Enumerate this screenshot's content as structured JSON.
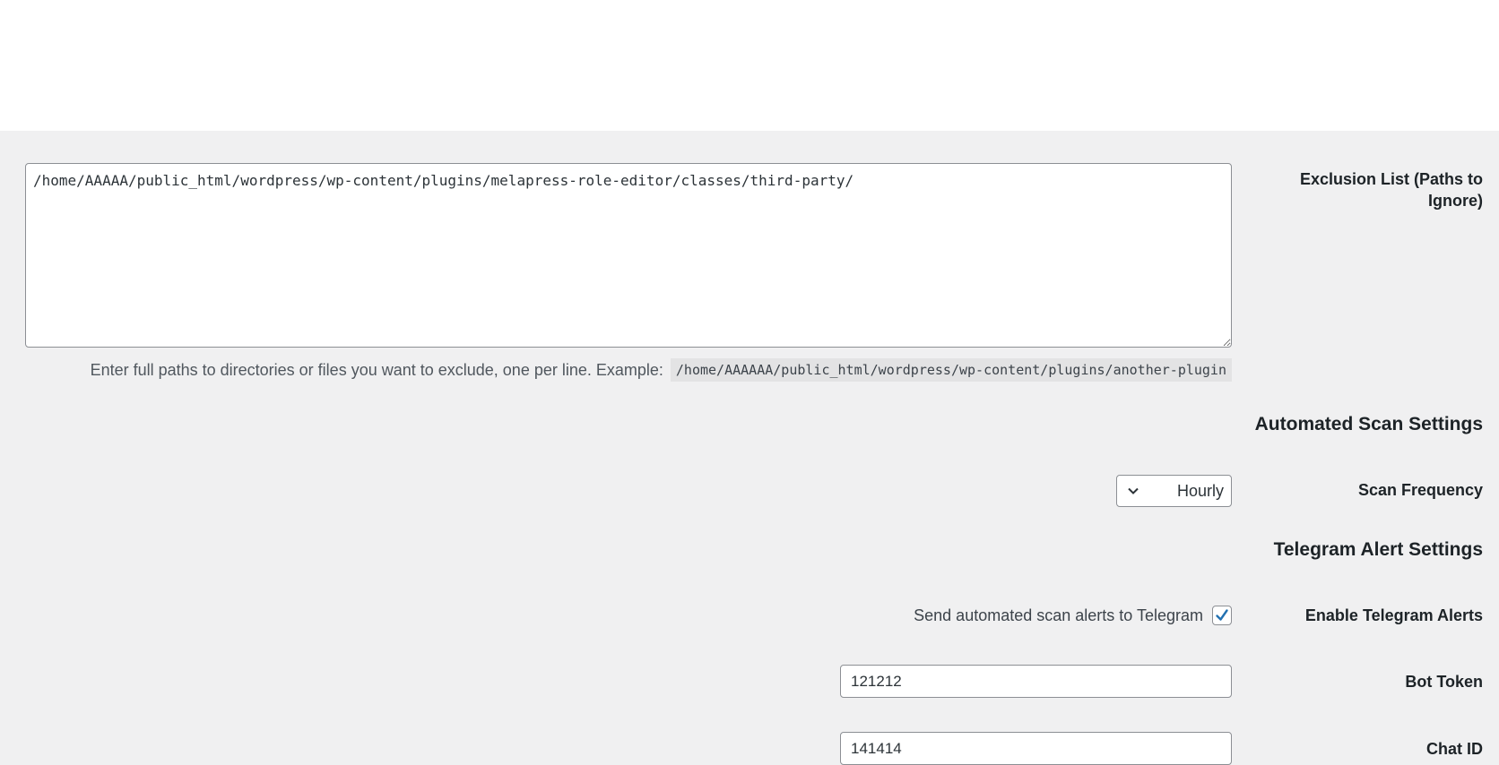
{
  "exclusion": {
    "label": "Exclusion List (Paths to Ignore)",
    "value": "/home/AAAAA/public_html/wordpress/wp-content/plugins/melapress-role-editor/classes/third-party/",
    "help_text": "Enter full paths to directories or files you want to exclude, one per line. Example:",
    "example_path": "/home/AAAAAA/public_html/wordpress/wp-content/plugins/another-plugin"
  },
  "automated_scan": {
    "section_title": "Automated Scan Settings",
    "frequency_label": "Scan Frequency",
    "frequency_value": "Hourly"
  },
  "telegram": {
    "section_title": "Telegram Alert Settings",
    "enable_label": "Enable Telegram Alerts",
    "enable_description": "Send automated scan alerts to Telegram",
    "enabled": true,
    "bot_token_label": "Bot Token",
    "bot_token_value": "121212",
    "chat_id_label": "Chat ID",
    "chat_id_value": "141414"
  },
  "colors": {
    "background": "#f0f0f1",
    "checkmark": "#2271b1"
  },
  "icons": {
    "select_chevron": "chevron-down-icon",
    "checkbox_check": "checkmark-icon"
  }
}
